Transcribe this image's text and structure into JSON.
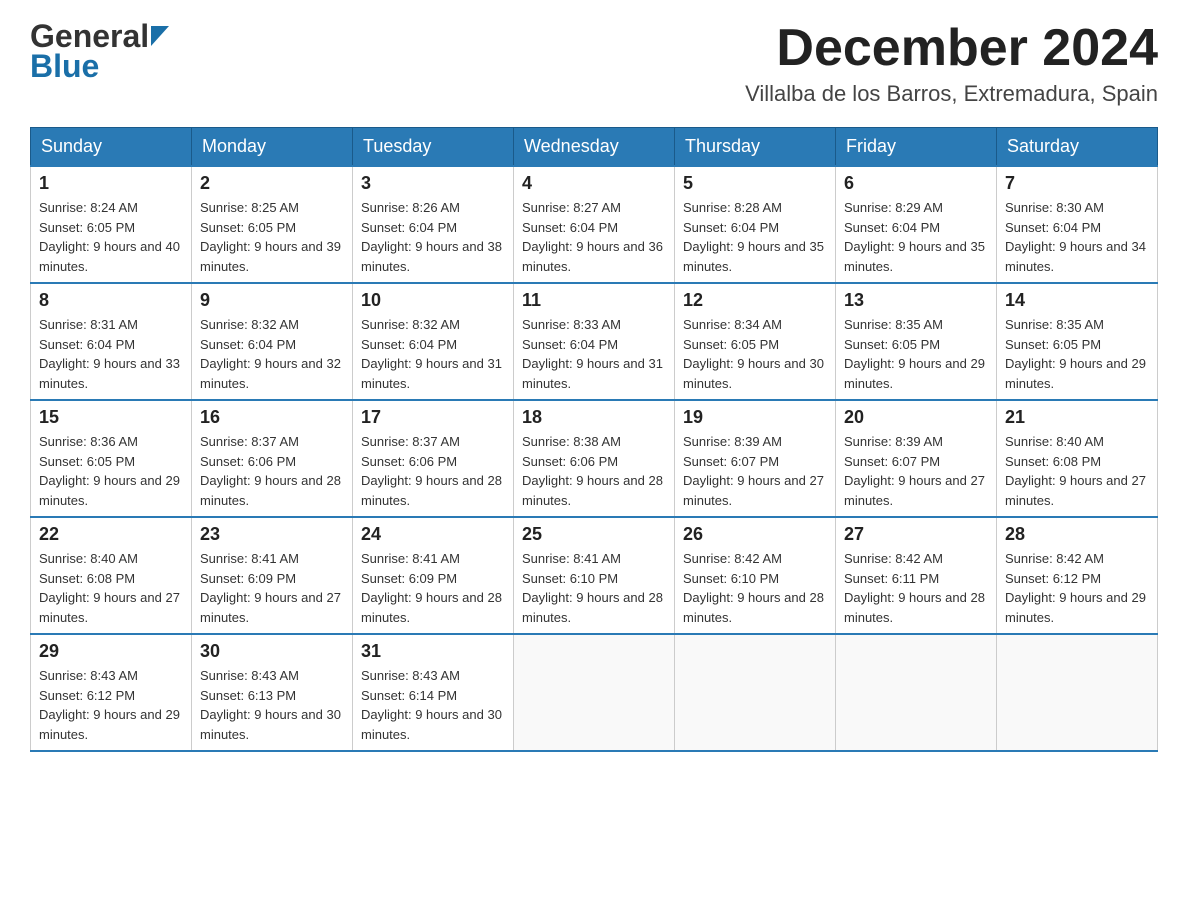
{
  "logo": {
    "part1": "General",
    "part2": "Blue"
  },
  "header": {
    "month_year": "December 2024",
    "location": "Villalba de los Barros, Extremadura, Spain"
  },
  "weekdays": [
    "Sunday",
    "Monday",
    "Tuesday",
    "Wednesday",
    "Thursday",
    "Friday",
    "Saturday"
  ],
  "weeks": [
    [
      {
        "day": "1",
        "sunrise": "8:24 AM",
        "sunset": "6:05 PM",
        "daylight": "9 hours and 40 minutes."
      },
      {
        "day": "2",
        "sunrise": "8:25 AM",
        "sunset": "6:05 PM",
        "daylight": "9 hours and 39 minutes."
      },
      {
        "day": "3",
        "sunrise": "8:26 AM",
        "sunset": "6:04 PM",
        "daylight": "9 hours and 38 minutes."
      },
      {
        "day": "4",
        "sunrise": "8:27 AM",
        "sunset": "6:04 PM",
        "daylight": "9 hours and 36 minutes."
      },
      {
        "day": "5",
        "sunrise": "8:28 AM",
        "sunset": "6:04 PM",
        "daylight": "9 hours and 35 minutes."
      },
      {
        "day": "6",
        "sunrise": "8:29 AM",
        "sunset": "6:04 PM",
        "daylight": "9 hours and 35 minutes."
      },
      {
        "day": "7",
        "sunrise": "8:30 AM",
        "sunset": "6:04 PM",
        "daylight": "9 hours and 34 minutes."
      }
    ],
    [
      {
        "day": "8",
        "sunrise": "8:31 AM",
        "sunset": "6:04 PM",
        "daylight": "9 hours and 33 minutes."
      },
      {
        "day": "9",
        "sunrise": "8:32 AM",
        "sunset": "6:04 PM",
        "daylight": "9 hours and 32 minutes."
      },
      {
        "day": "10",
        "sunrise": "8:32 AM",
        "sunset": "6:04 PM",
        "daylight": "9 hours and 31 minutes."
      },
      {
        "day": "11",
        "sunrise": "8:33 AM",
        "sunset": "6:04 PM",
        "daylight": "9 hours and 31 minutes."
      },
      {
        "day": "12",
        "sunrise": "8:34 AM",
        "sunset": "6:05 PM",
        "daylight": "9 hours and 30 minutes."
      },
      {
        "day": "13",
        "sunrise": "8:35 AM",
        "sunset": "6:05 PM",
        "daylight": "9 hours and 29 minutes."
      },
      {
        "day": "14",
        "sunrise": "8:35 AM",
        "sunset": "6:05 PM",
        "daylight": "9 hours and 29 minutes."
      }
    ],
    [
      {
        "day": "15",
        "sunrise": "8:36 AM",
        "sunset": "6:05 PM",
        "daylight": "9 hours and 29 minutes."
      },
      {
        "day": "16",
        "sunrise": "8:37 AM",
        "sunset": "6:06 PM",
        "daylight": "9 hours and 28 minutes."
      },
      {
        "day": "17",
        "sunrise": "8:37 AM",
        "sunset": "6:06 PM",
        "daylight": "9 hours and 28 minutes."
      },
      {
        "day": "18",
        "sunrise": "8:38 AM",
        "sunset": "6:06 PM",
        "daylight": "9 hours and 28 minutes."
      },
      {
        "day": "19",
        "sunrise": "8:39 AM",
        "sunset": "6:07 PM",
        "daylight": "9 hours and 27 minutes."
      },
      {
        "day": "20",
        "sunrise": "8:39 AM",
        "sunset": "6:07 PM",
        "daylight": "9 hours and 27 minutes."
      },
      {
        "day": "21",
        "sunrise": "8:40 AM",
        "sunset": "6:08 PM",
        "daylight": "9 hours and 27 minutes."
      }
    ],
    [
      {
        "day": "22",
        "sunrise": "8:40 AM",
        "sunset": "6:08 PM",
        "daylight": "9 hours and 27 minutes."
      },
      {
        "day": "23",
        "sunrise": "8:41 AM",
        "sunset": "6:09 PM",
        "daylight": "9 hours and 27 minutes."
      },
      {
        "day": "24",
        "sunrise": "8:41 AM",
        "sunset": "6:09 PM",
        "daylight": "9 hours and 28 minutes."
      },
      {
        "day": "25",
        "sunrise": "8:41 AM",
        "sunset": "6:10 PM",
        "daylight": "9 hours and 28 minutes."
      },
      {
        "day": "26",
        "sunrise": "8:42 AM",
        "sunset": "6:10 PM",
        "daylight": "9 hours and 28 minutes."
      },
      {
        "day": "27",
        "sunrise": "8:42 AM",
        "sunset": "6:11 PM",
        "daylight": "9 hours and 28 minutes."
      },
      {
        "day": "28",
        "sunrise": "8:42 AM",
        "sunset": "6:12 PM",
        "daylight": "9 hours and 29 minutes."
      }
    ],
    [
      {
        "day": "29",
        "sunrise": "8:43 AM",
        "sunset": "6:12 PM",
        "daylight": "9 hours and 29 minutes."
      },
      {
        "day": "30",
        "sunrise": "8:43 AM",
        "sunset": "6:13 PM",
        "daylight": "9 hours and 30 minutes."
      },
      {
        "day": "31",
        "sunrise": "8:43 AM",
        "sunset": "6:14 PM",
        "daylight": "9 hours and 30 minutes."
      },
      null,
      null,
      null,
      null
    ]
  ]
}
